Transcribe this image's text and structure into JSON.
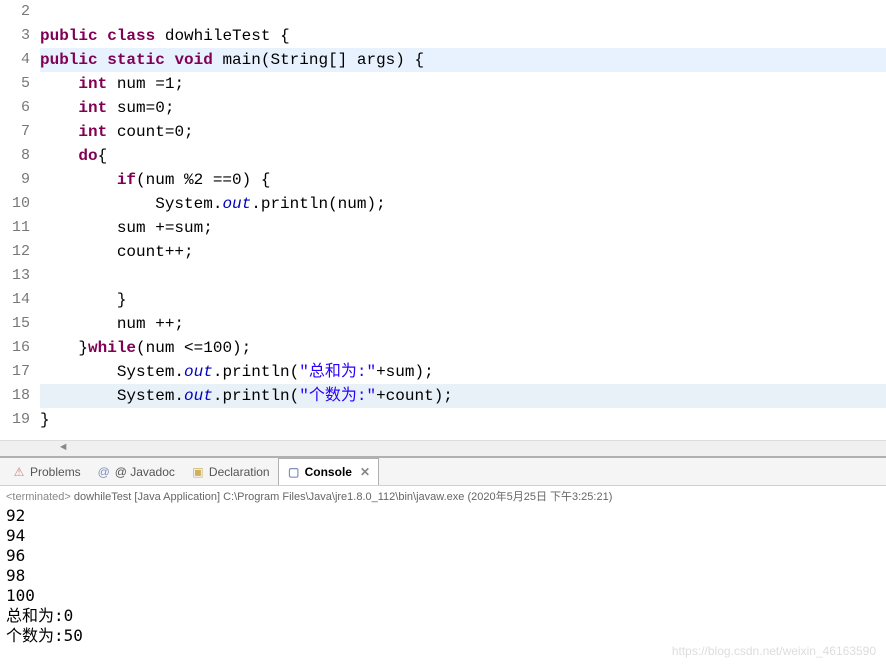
{
  "code": {
    "lines": [
      {
        "num": "2",
        "content": ""
      },
      {
        "num": "3",
        "tokens": [
          {
            "t": "kw",
            "v": "public"
          },
          {
            "t": "sp",
            "v": " "
          },
          {
            "t": "kw",
            "v": "class"
          },
          {
            "t": "sp",
            "v": " "
          },
          {
            "t": "normal",
            "v": "dowhileTest {"
          }
        ]
      },
      {
        "num": "4",
        "highlight": true,
        "tokens": [
          {
            "t": "kw",
            "v": "public"
          },
          {
            "t": "sp",
            "v": " "
          },
          {
            "t": "kw",
            "v": "static"
          },
          {
            "t": "sp",
            "v": " "
          },
          {
            "t": "kw",
            "v": "void"
          },
          {
            "t": "sp",
            "v": " "
          },
          {
            "t": "normal",
            "v": "main(String[] args) {"
          }
        ]
      },
      {
        "num": "5",
        "indent": "    ",
        "tokens": [
          {
            "t": "kw",
            "v": "int"
          },
          {
            "t": "sp",
            "v": " "
          },
          {
            "t": "normal",
            "v": "num =1;"
          }
        ]
      },
      {
        "num": "6",
        "indent": "    ",
        "tokens": [
          {
            "t": "kw",
            "v": "int"
          },
          {
            "t": "sp",
            "v": " "
          },
          {
            "t": "normal",
            "v": "sum=0;"
          }
        ]
      },
      {
        "num": "7",
        "indent": "    ",
        "tokens": [
          {
            "t": "kw",
            "v": "int"
          },
          {
            "t": "sp",
            "v": " "
          },
          {
            "t": "normal",
            "v": "count=0;"
          }
        ]
      },
      {
        "num": "8",
        "indent": "    ",
        "tokens": [
          {
            "t": "kw",
            "v": "do"
          },
          {
            "t": "normal",
            "v": "{"
          }
        ]
      },
      {
        "num": "9",
        "indent": "        ",
        "tokens": [
          {
            "t": "kw",
            "v": "if"
          },
          {
            "t": "normal",
            "v": "(num %2 ==0) {"
          }
        ]
      },
      {
        "num": "10",
        "indent": "            ",
        "tokens": [
          {
            "t": "normal",
            "v": "System."
          },
          {
            "t": "field",
            "v": "out"
          },
          {
            "t": "normal",
            "v": ".println(num);"
          }
        ]
      },
      {
        "num": "11",
        "indent": "        ",
        "tokens": [
          {
            "t": "normal",
            "v": "sum +=sum;"
          }
        ]
      },
      {
        "num": "12",
        "indent": "        ",
        "tokens": [
          {
            "t": "normal",
            "v": "count++;"
          }
        ]
      },
      {
        "num": "13",
        "indent": "        ",
        "content": ""
      },
      {
        "num": "14",
        "indent": "        ",
        "tokens": [
          {
            "t": "normal",
            "v": "}"
          }
        ]
      },
      {
        "num": "15",
        "indent": "        ",
        "tokens": [
          {
            "t": "normal",
            "v": "num ++;"
          }
        ]
      },
      {
        "num": "16",
        "indent": "    ",
        "tokens": [
          {
            "t": "normal",
            "v": "}"
          },
          {
            "t": "kw",
            "v": "while"
          },
          {
            "t": "normal",
            "v": "(num <=100);"
          }
        ]
      },
      {
        "num": "17",
        "indent": "        ",
        "tokens": [
          {
            "t": "normal",
            "v": "System."
          },
          {
            "t": "field",
            "v": "out"
          },
          {
            "t": "normal",
            "v": ".println("
          },
          {
            "t": "str",
            "v": "\"总和为:\""
          },
          {
            "t": "normal",
            "v": "+sum);"
          }
        ]
      },
      {
        "num": "18",
        "indent": "        ",
        "current": true,
        "tokens": [
          {
            "t": "normal",
            "v": "System."
          },
          {
            "t": "field",
            "v": "out"
          },
          {
            "t": "normal",
            "v": ".println("
          },
          {
            "t": "str",
            "v": "\"个数为:\""
          },
          {
            "t": "normal",
            "v": "+count);"
          }
        ]
      },
      {
        "num": "19",
        "tokens": [
          {
            "t": "normal",
            "v": "}"
          }
        ]
      }
    ]
  },
  "tabs": {
    "problems": "Problems",
    "javadoc": "@ Javadoc",
    "declaration": "Declaration",
    "console": "Console"
  },
  "console": {
    "status": "<terminated>",
    "title": "dowhileTest [Java Application] C:\\Program Files\\Java\\jre1.8.0_112\\bin\\javaw.exe (2020年5月25日 下午3:25:21)",
    "output": [
      "92",
      "94",
      "96",
      "98",
      "100",
      "总和为:0",
      "个数为:50"
    ]
  },
  "watermark": "https://blog.csdn.net/weixin_46163590"
}
